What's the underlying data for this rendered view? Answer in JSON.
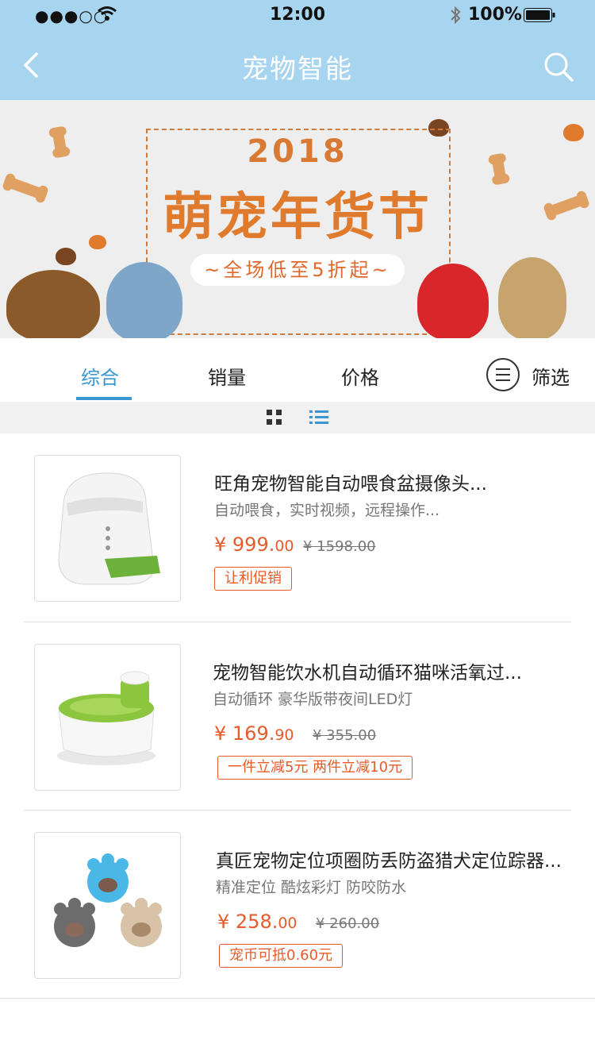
{
  "status": {
    "signal": "●●●○○",
    "time": "12:00",
    "battery": "100%"
  },
  "nav": {
    "title": "宠物智能"
  },
  "banner": {
    "year": "2018",
    "headline": "萌宠年货节",
    "promo": "~全场低至5折起~"
  },
  "sort_tabs": [
    {
      "label": "综合",
      "active": true
    },
    {
      "label": "销量"
    },
    {
      "label": "价格"
    }
  ],
  "filter": {
    "label": "筛选"
  },
  "colors": {
    "nav_bg": "#a7d4ee",
    "accent": "#3a96cf",
    "price": "#e65b2a"
  },
  "products": [
    {
      "name": "旺角宠物智能自动喂食盆摄像头...",
      "desc": "自动喂食，实时视频，远程操作...",
      "price_int": "¥ 999.",
      "price_dec": "00",
      "orig_price": "¥ 1598.00",
      "tag": "让利促销"
    },
    {
      "name": "宠物智能饮水机自动循环猫咪活氧过...",
      "desc": "自动循环 豪华版带夜间LED灯",
      "price_int": "¥ 169.",
      "price_dec": "90",
      "orig_price": "¥ 355.00",
      "tag": "一件立减5元 两件立减10元"
    },
    {
      "name": "真匠宠物定位项圈防丢防盗猎犬定位踪器...",
      "desc": "精准定位  酷炫彩灯   防咬防水",
      "price_int": "¥ 258.",
      "price_dec": "00",
      "orig_price": "¥ 260.00",
      "tag": "宠币可抵0.60元"
    }
  ]
}
